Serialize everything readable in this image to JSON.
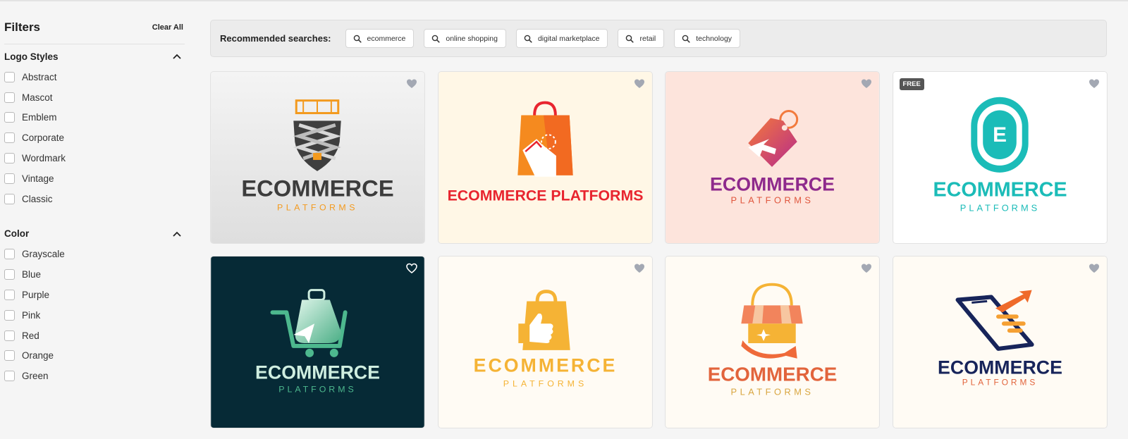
{
  "sidebar": {
    "title": "Filters",
    "clear_all": "Clear All",
    "sections": [
      {
        "title": "Logo Styles",
        "expanded": true,
        "options": [
          "Abstract",
          "Mascot",
          "Emblem",
          "Corporate",
          "Wordmark",
          "Vintage",
          "Classic"
        ]
      },
      {
        "title": "Color",
        "expanded": true,
        "options": [
          "Grayscale",
          "Blue",
          "Purple",
          "Pink",
          "Red",
          "Orange",
          "Green"
        ]
      }
    ]
  },
  "recommended": {
    "label": "Recommended searches:",
    "chips": [
      "ecommerce",
      "online shopping",
      "digital marketplace",
      "retail",
      "technology"
    ]
  },
  "cards": [
    {
      "word1": "ECOMMERCE",
      "word2": "PLATFORMS",
      "background": "#e9e9e9",
      "icon": "scissor-lift-shield-icon",
      "free": false
    },
    {
      "word1": "ECOMMERCE PLATFORMS",
      "word2": "",
      "background": "#fff7e6",
      "icon": "shopping-bag-hand-icon",
      "free": false
    },
    {
      "word1": "ECOMMERCE",
      "word2": "PLATFORMS",
      "background": "#fde4dc",
      "icon": "price-tag-cursor-icon",
      "free": false
    },
    {
      "word1": "ECOMMERCE",
      "word2": "PLATFORMS",
      "background": "#ffffff",
      "icon": "letter-e-badge-icon",
      "free": true,
      "badge": "FREE"
    },
    {
      "word1": "ECOMMERCE",
      "word2": "PLATFORMS",
      "background": "#062a36",
      "icon": "shopping-cart-bag-icon",
      "free": false
    },
    {
      "word1": "ECOMMERCE",
      "word2": "PLATFORMS",
      "background": "#fffbf4",
      "icon": "bag-thumbs-up-icon",
      "free": false
    },
    {
      "word1": "ECOMMERCE",
      "word2": "PLATFORMS",
      "background": "#fffbf4",
      "icon": "storefront-awning-icon",
      "free": false
    },
    {
      "word1": "ECOMMERCE",
      "word2": "PLATFORMS",
      "background": "#fffbf4",
      "icon": "mobile-delivery-icon",
      "free": false
    }
  ]
}
